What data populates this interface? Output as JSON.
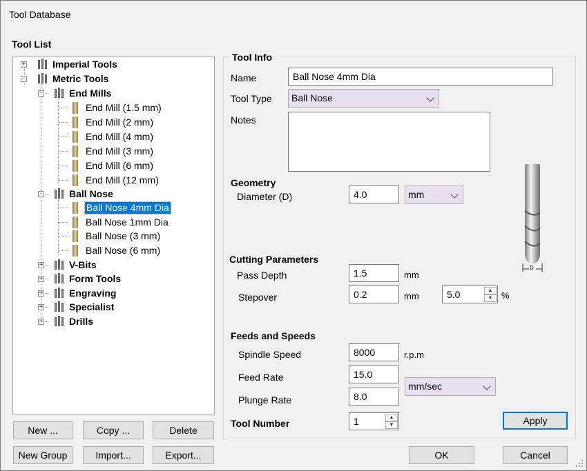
{
  "window": {
    "title": "Tool Database"
  },
  "tool_list": {
    "label": "Tool List",
    "tree": [
      {
        "label": "Imperial Tools",
        "expander": "+"
      },
      {
        "label": "Metric Tools",
        "expander": "-"
      },
      {
        "label": "End Mills",
        "expander": "-"
      },
      {
        "label": "End Mill (1.5 mm)"
      },
      {
        "label": "End Mill (2 mm)"
      },
      {
        "label": "End Mill (4 mm)"
      },
      {
        "label": "End Mill (3 mm)"
      },
      {
        "label": "End Mill (6 mm)"
      },
      {
        "label": "End Mill (12 mm)"
      },
      {
        "label": "Ball Nose",
        "expander": "-"
      },
      {
        "label": "Ball Nose 4mm Dia"
      },
      {
        "label": "Ball Nose 1mm Dia"
      },
      {
        "label": "Ball Nose (3 mm)"
      },
      {
        "label": "Ball Nose (6 mm)"
      },
      {
        "label": "V-Bits",
        "expander": "+"
      },
      {
        "label": "Form Tools",
        "expander": "+"
      },
      {
        "label": "Engraving",
        "expander": "+"
      },
      {
        "label": "Specialist",
        "expander": "+"
      },
      {
        "label": "Drills",
        "expander": "+"
      }
    ],
    "buttons": {
      "new": "New ...",
      "copy": "Copy ...",
      "delete": "Delete",
      "new_group": "New Group",
      "import": "Import...",
      "export": "Export..."
    }
  },
  "tool_info": {
    "title": "Tool Info",
    "name_label": "Name",
    "name_value": "Ball Nose 4mm Dia",
    "tool_type_label": "Tool Type",
    "tool_type_value": "Ball Nose",
    "notes_label": "Notes",
    "notes_value": ""
  },
  "geometry": {
    "title": "Geometry",
    "diameter_label": "Diameter (D)",
    "diameter_value": "4.0",
    "unit_value": "mm"
  },
  "cutting": {
    "title": "Cutting Parameters",
    "pass_depth_label": "Pass Depth",
    "pass_depth_value": "1.5",
    "pass_depth_unit": "mm",
    "stepover_label": "Stepover",
    "stepover_value": "0.2",
    "stepover_unit": "mm",
    "stepover_percent_value": "5.0",
    "percent_sign": "%"
  },
  "feeds": {
    "title": "Feeds and Speeds",
    "spindle_label": "Spindle Speed",
    "spindle_value": "8000",
    "spindle_unit": "r.p.m",
    "feed_label": "Feed Rate",
    "feed_value": "15.0",
    "plunge_label": "Plunge Rate",
    "plunge_value": "8.0",
    "rate_unit_value": "mm/sec"
  },
  "tool_number": {
    "label": "Tool Number",
    "value": "1"
  },
  "dialog_buttons": {
    "apply": "Apply",
    "ok": "OK",
    "cancel": "Cancel"
  },
  "diagram": {
    "d_label": "D"
  },
  "colors": {
    "selection": "#0078d7",
    "select_bg": "#e8dff0"
  }
}
